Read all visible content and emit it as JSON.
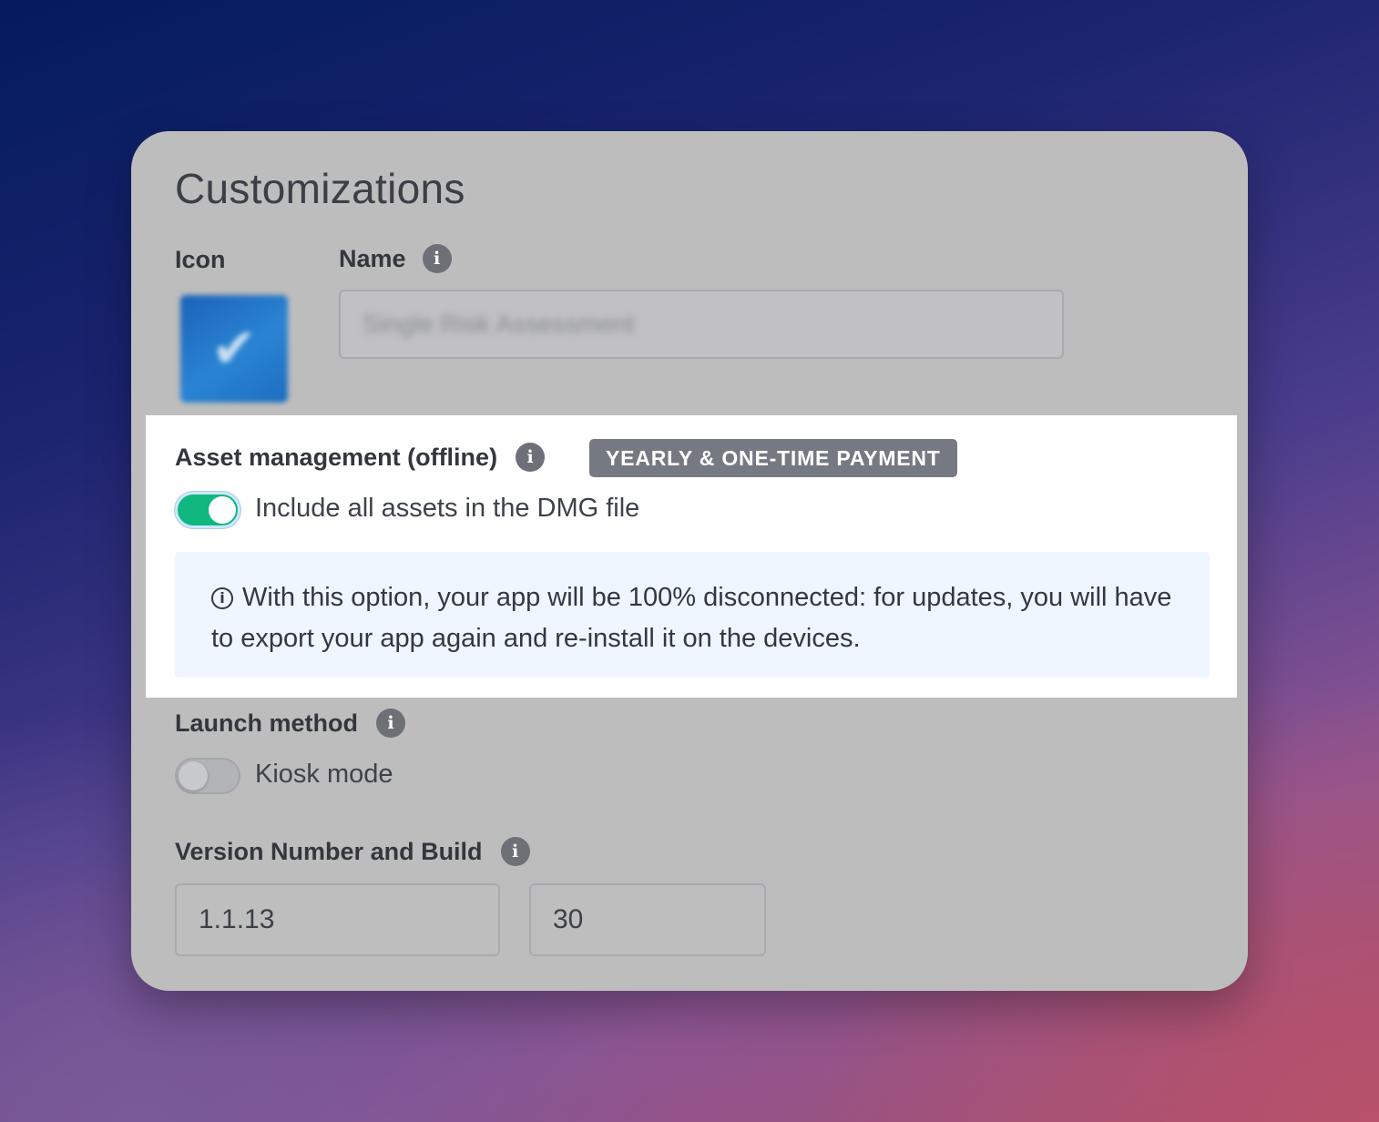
{
  "title": "Customizations",
  "icon_section": {
    "label": "Icon",
    "glyph": "✔"
  },
  "name_section": {
    "label": "Name",
    "value": "Single Risk Assessment"
  },
  "asset_management": {
    "label": "Asset management (offline)",
    "badge": "YEARLY & ONE-TIME PAYMENT",
    "toggle_label": "Include all assets in the DMG file",
    "toggle_on": true,
    "note": "With this option, your app will be 100% disconnected: for updates, you will have to export your app again and re-install it on the devices.",
    "note_icon": "i"
  },
  "launch_method": {
    "label": "Launch method",
    "toggle_label": "Kiosk mode",
    "toggle_on": false
  },
  "version": {
    "label": "Version Number and Build",
    "number": "1.1.13",
    "build": "30"
  },
  "info_glyph": "i",
  "colors": {
    "toggle_on": "#10b87f",
    "badge": "#757981",
    "note_bg": "#eff6ff"
  }
}
